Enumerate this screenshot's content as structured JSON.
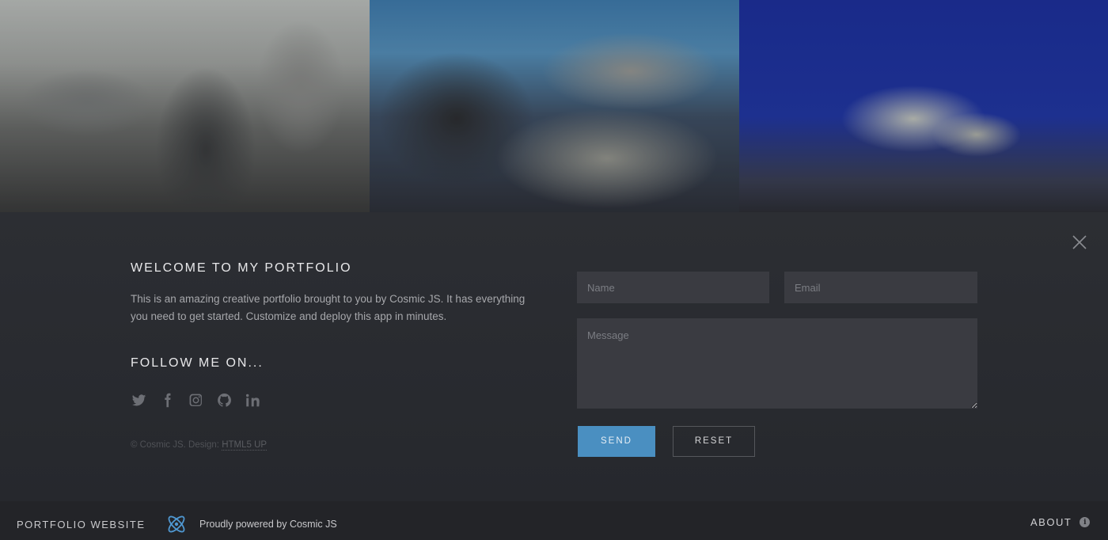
{
  "hero": {
    "photos": [
      "city-skyline",
      "harbour-view",
      "opera-house"
    ]
  },
  "intro": {
    "title": "WELCOME TO MY PORTFOLIO",
    "text": "This is an amazing creative portfolio brought to you by Cosmic JS.  It has everything you need to get started.  Customize and deploy this app in minutes."
  },
  "follow": {
    "title": "FOLLOW ME ON...",
    "networks": [
      "twitter-icon",
      "facebook-icon",
      "instagram-icon",
      "github-icon",
      "linkedin-icon"
    ]
  },
  "copyright": {
    "prefix": "© Cosmic JS. Design: ",
    "link": "HTML5 UP"
  },
  "form": {
    "name_placeholder": "Name",
    "email_placeholder": "Email",
    "message_placeholder": "Message",
    "send_label": "SEND",
    "reset_label": "RESET"
  },
  "footer": {
    "title": "PORTFOLIO WEBSITE",
    "powered": "Proudly powered by Cosmic JS",
    "about": "ABOUT"
  },
  "colors": {
    "accent": "#4a8fc1",
    "panel": "#26282d",
    "field": "#3a3b41"
  }
}
